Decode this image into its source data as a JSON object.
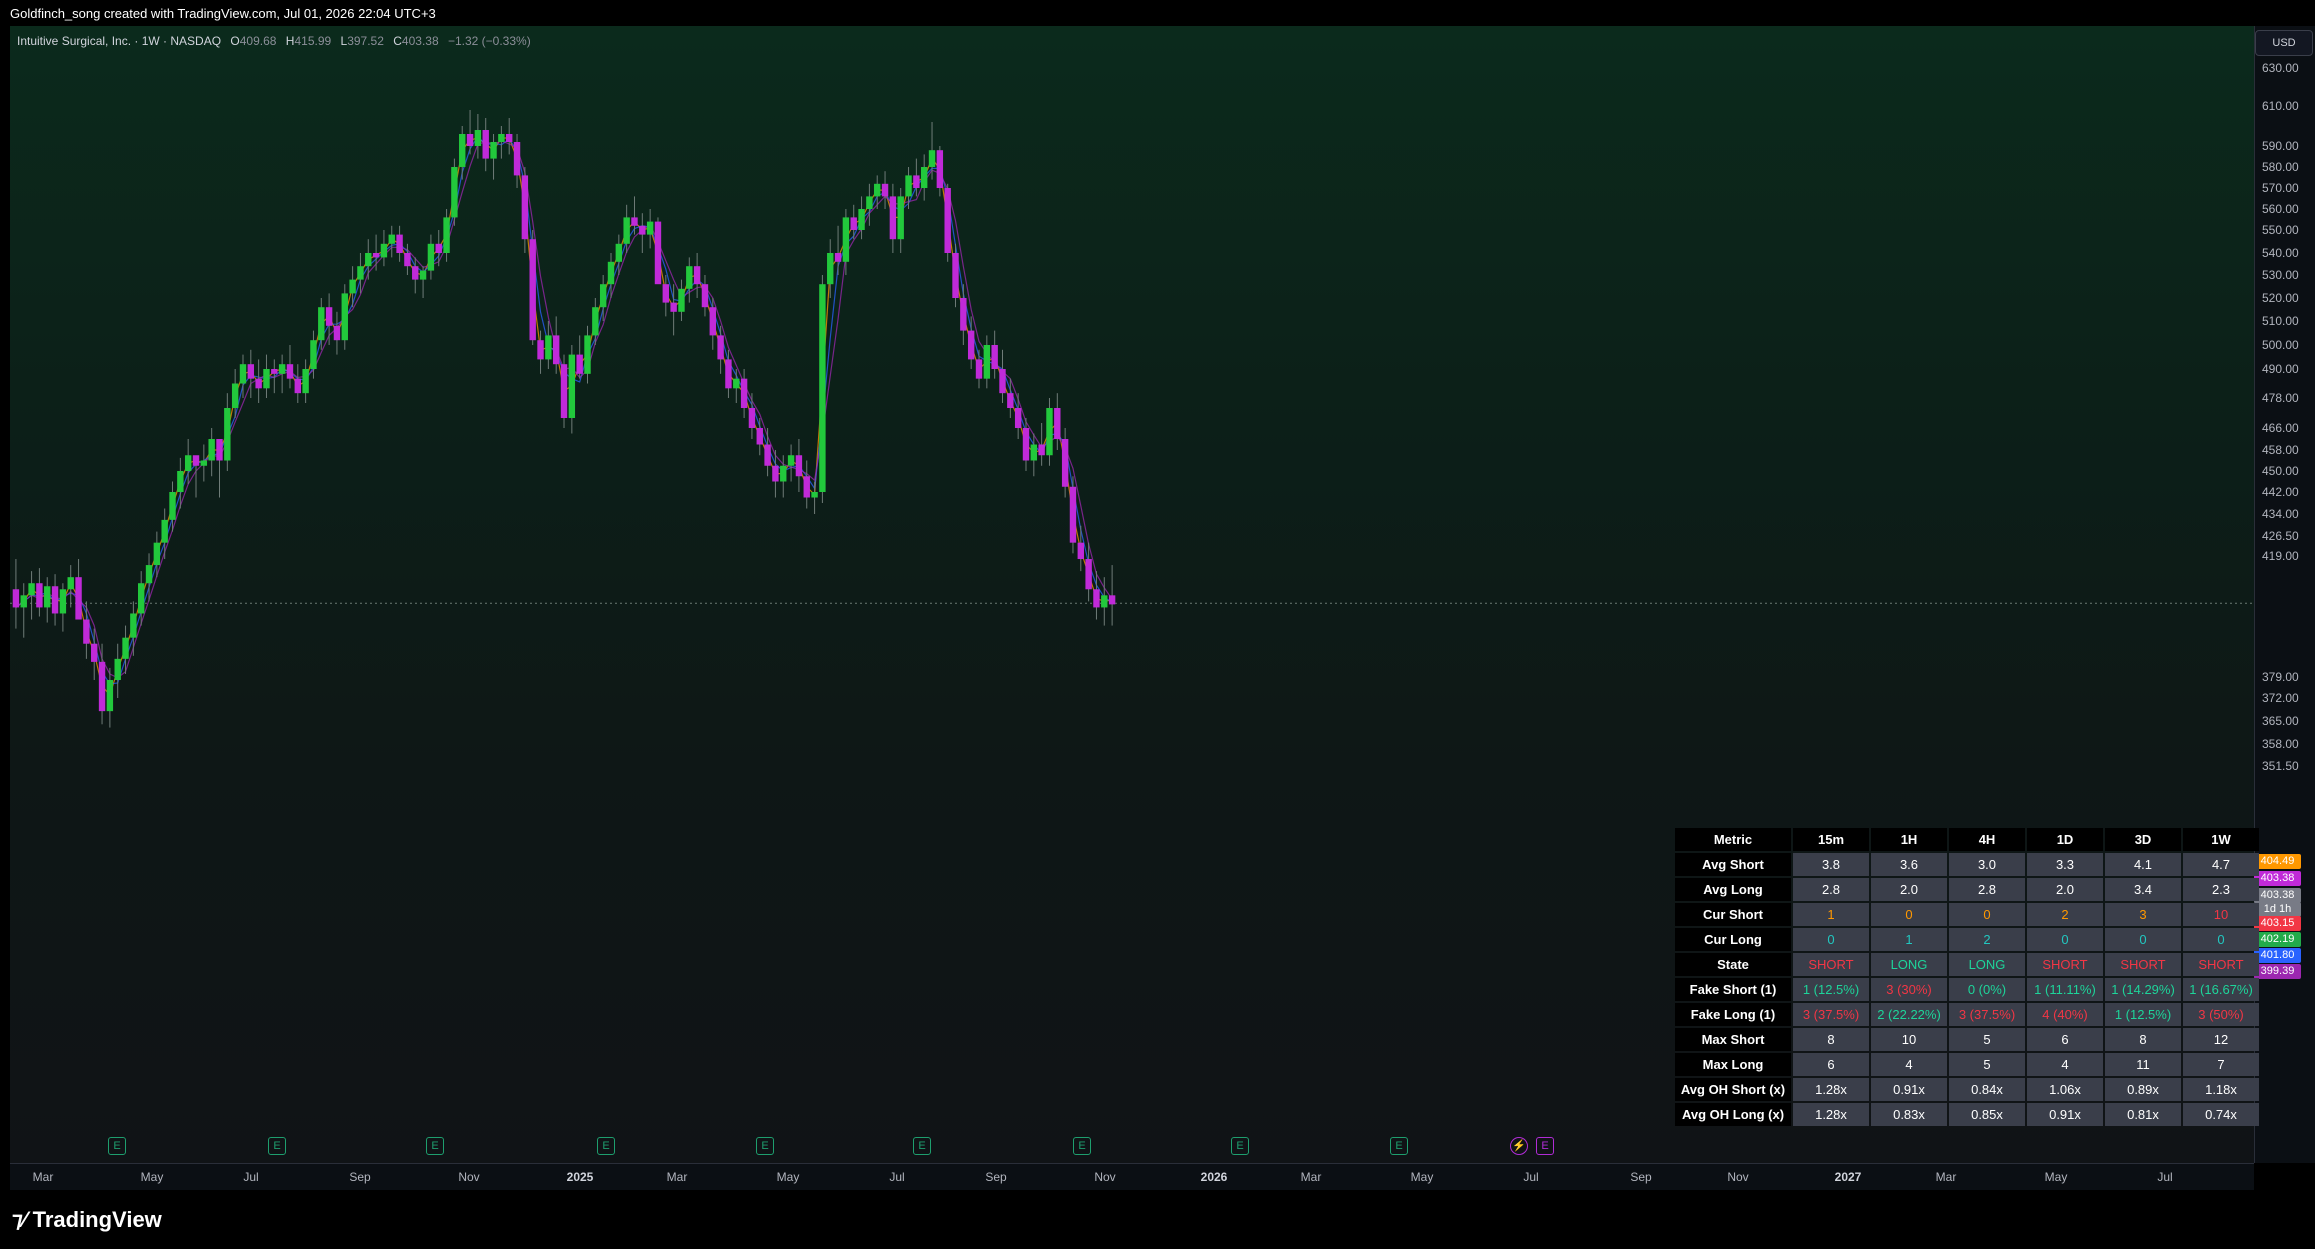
{
  "header": {
    "title": "Goldfinch_song created with TradingView.com, Jul 01, 2026 22:04 UTC+3"
  },
  "legend": {
    "symbol": "Intuitive Surgical, Inc. · 1W · NASDAQ",
    "o_label": "O",
    "o": "409.68",
    "h_label": "H",
    "h": "415.99",
    "l_label": "L",
    "l": "397.52",
    "c_label": "C",
    "c": "403.38",
    "chg": "−1.32 (−0.33%)"
  },
  "currency": "USD",
  "price_axis": [
    "630.00",
    "610.00",
    "590.00",
    "580.00",
    "570.00",
    "560.00",
    "550.00",
    "540.00",
    "530.00",
    "520.00",
    "510.00",
    "500.00",
    "490.00",
    "478.00",
    "466.00",
    "458.00",
    "450.00",
    "442.00",
    "434.00",
    "426.50",
    "419.00",
    "379.00",
    "372.00",
    "365.00",
    "358.00",
    "351.50"
  ],
  "price_tags": [
    {
      "text": "404.49",
      "color": "#ff9800"
    },
    {
      "text": "403.38",
      "color": "#c02ad8"
    },
    {
      "text": "403.38",
      "color": "#787b86"
    },
    {
      "text": "1d 1h",
      "color": "#787b86"
    },
    {
      "text": "403.15",
      "color": "#f23645"
    },
    {
      "text": "402.19",
      "color": "#22ab4a"
    },
    {
      "text": "401.80",
      "color": "#2962ff"
    },
    {
      "text": "399.39",
      "color": "#9c27b0"
    }
  ],
  "time_axis": [
    {
      "t": "Mar",
      "b": false
    },
    {
      "t": "May",
      "b": false
    },
    {
      "t": "Jul",
      "b": false
    },
    {
      "t": "Sep",
      "b": false
    },
    {
      "t": "Nov",
      "b": false
    },
    {
      "t": "2025",
      "b": true
    },
    {
      "t": "Mar",
      "b": false
    },
    {
      "t": "May",
      "b": false
    },
    {
      "t": "Jul",
      "b": false
    },
    {
      "t": "Sep",
      "b": false
    },
    {
      "t": "Nov",
      "b": false
    },
    {
      "t": "2026",
      "b": true
    },
    {
      "t": "Mar",
      "b": false
    },
    {
      "t": "May",
      "b": false
    },
    {
      "t": "Jul",
      "b": false
    },
    {
      "t": "Sep",
      "b": false
    },
    {
      "t": "Nov",
      "b": false
    },
    {
      "t": "2027",
      "b": true
    },
    {
      "t": "Mar",
      "b": false
    },
    {
      "t": "May",
      "b": false
    },
    {
      "t": "Jul",
      "b": false
    }
  ],
  "earnings_markers": [
    "E",
    "E",
    "E",
    "E",
    "E",
    "E",
    "E",
    "E",
    "E",
    "E"
  ],
  "table": {
    "headers": [
      "Metric",
      "15m",
      "1H",
      "4H",
      "1D",
      "3D",
      "1W"
    ],
    "rows": [
      {
        "metric": "Avg Short",
        "cells": [
          "3.8",
          "3.6",
          "3.0",
          "3.3",
          "4.1",
          "4.7"
        ],
        "colors": [
          "w",
          "w",
          "w",
          "w",
          "w",
          "w"
        ]
      },
      {
        "metric": "Avg Long",
        "cells": [
          "2.8",
          "2.0",
          "2.8",
          "2.0",
          "3.4",
          "2.3"
        ],
        "colors": [
          "w",
          "w",
          "w",
          "w",
          "w",
          "w"
        ]
      },
      {
        "metric": "Cur Short",
        "cells": [
          "1",
          "0",
          "0",
          "2",
          "3",
          "10"
        ],
        "colors": [
          "o",
          "o",
          "o",
          "o",
          "o",
          "r"
        ]
      },
      {
        "metric": "Cur Long",
        "cells": [
          "0",
          "1",
          "2",
          "0",
          "0",
          "0"
        ],
        "colors": [
          "cy",
          "cy",
          "cy",
          "cy",
          "cy",
          "cy"
        ]
      },
      {
        "metric": "State",
        "cells": [
          "SHORT",
          "LONG",
          "LONG",
          "SHORT",
          "SHORT",
          "SHORT"
        ],
        "colors": [
          "r",
          "g",
          "g",
          "r",
          "r",
          "r"
        ]
      },
      {
        "metric": "Fake Short (1)",
        "cells": [
          "1 (12.5%)",
          "3 (30%)",
          "0 (0%)",
          "1 (11.11%)",
          "1 (14.29%)",
          "1 (16.67%)"
        ],
        "colors": [
          "g",
          "r",
          "g",
          "g",
          "g",
          "g"
        ]
      },
      {
        "metric": "Fake Long (1)",
        "cells": [
          "3 (37.5%)",
          "2 (22.22%)",
          "3 (37.5%)",
          "4 (40%)",
          "1 (12.5%)",
          "3 (50%)"
        ],
        "colors": [
          "r",
          "g",
          "r",
          "r",
          "g",
          "r"
        ]
      },
      {
        "metric": "Max Short",
        "cells": [
          "8",
          "10",
          "5",
          "6",
          "8",
          "12"
        ],
        "colors": [
          "w",
          "w",
          "w",
          "w",
          "w",
          "w"
        ]
      },
      {
        "metric": "Max Long",
        "cells": [
          "6",
          "4",
          "5",
          "4",
          "11",
          "7"
        ],
        "colors": [
          "w",
          "w",
          "w",
          "w",
          "w",
          "w"
        ]
      },
      {
        "metric": "Avg OH Short (x)",
        "cells": [
          "1.28x",
          "0.91x",
          "0.84x",
          "1.06x",
          "0.89x",
          "1.18x"
        ],
        "colors": [
          "w",
          "w",
          "w",
          "w",
          "w",
          "w"
        ]
      },
      {
        "metric": "Avg OH Long (x)",
        "cells": [
          "1.28x",
          "0.83x",
          "0.85x",
          "0.91x",
          "0.81x",
          "0.74x"
        ],
        "colors": [
          "w",
          "w",
          "w",
          "w",
          "w",
          "w"
        ]
      }
    ]
  },
  "candles": [
    [
      408,
      418,
      395,
      402
    ],
    [
      402,
      410,
      392,
      406
    ],
    [
      406,
      414,
      398,
      410
    ],
    [
      410,
      415,
      399,
      402
    ],
    [
      402,
      412,
      397,
      409
    ],
    [
      409,
      413,
      396,
      400
    ],
    [
      400,
      410,
      394,
      408
    ],
    [
      408,
      416,
      402,
      412
    ],
    [
      412,
      418,
      405,
      398
    ],
    [
      398,
      404,
      385,
      390
    ],
    [
      390,
      395,
      378,
      384
    ],
    [
      384,
      390,
      364,
      368
    ],
    [
      368,
      382,
      363,
      378
    ],
    [
      378,
      390,
      372,
      385
    ],
    [
      385,
      396,
      380,
      392
    ],
    [
      392,
      404,
      386,
      400
    ],
    [
      400,
      414,
      396,
      410
    ],
    [
      410,
      420,
      404,
      416
    ],
    [
      416,
      428,
      412,
      424
    ],
    [
      424,
      436,
      418,
      432
    ],
    [
      432,
      446,
      428,
      442
    ],
    [
      442,
      455,
      436,
      450
    ],
    [
      450,
      462,
      445,
      456
    ],
    [
      456,
      455,
      440,
      452
    ],
    [
      452,
      460,
      446,
      454
    ],
    [
      454,
      466,
      448,
      462
    ],
    [
      462,
      458,
      440,
      454
    ],
    [
      454,
      480,
      450,
      474
    ],
    [
      474,
      490,
      470,
      484
    ],
    [
      484,
      496,
      478,
      492
    ],
    [
      492,
      498,
      478,
      486
    ],
    [
      486,
      494,
      476,
      482
    ],
    [
      482,
      496,
      478,
      490
    ],
    [
      490,
      494,
      480,
      488
    ],
    [
      488,
      496,
      480,
      492
    ],
    [
      492,
      500,
      482,
      486
    ],
    [
      486,
      492,
      476,
      480
    ],
    [
      480,
      494,
      476,
      490
    ],
    [
      490,
      506,
      486,
      502
    ],
    [
      502,
      520,
      498,
      516
    ],
    [
      516,
      522,
      500,
      508
    ],
    [
      508,
      514,
      496,
      502
    ],
    [
      502,
      526,
      498,
      522
    ],
    [
      522,
      534,
      516,
      528
    ],
    [
      528,
      540,
      522,
      534
    ],
    [
      534,
      546,
      528,
      540
    ],
    [
      540,
      548,
      532,
      538
    ],
    [
      538,
      550,
      534,
      544
    ],
    [
      544,
      552,
      538,
      548
    ],
    [
      548,
      552,
      536,
      540
    ],
    [
      540,
      544,
      530,
      534
    ],
    [
      534,
      538,
      522,
      528
    ],
    [
      528,
      534,
      520,
      532
    ],
    [
      532,
      548,
      528,
      544
    ],
    [
      544,
      550,
      534,
      540
    ],
    [
      540,
      560,
      536,
      556
    ],
    [
      556,
      584,
      552,
      580
    ],
    [
      580,
      600,
      574,
      596
    ],
    [
      596,
      608,
      586,
      590
    ],
    [
      590,
      606,
      584,
      598
    ],
    [
      598,
      604,
      578,
      584
    ],
    [
      584,
      596,
      574,
      592
    ],
    [
      592,
      600,
      584,
      596
    ],
    [
      596,
      604,
      586,
      592
    ],
    [
      592,
      596,
      570,
      576
    ],
    [
      576,
      580,
      540,
      546
    ],
    [
      546,
      550,
      500,
      502
    ],
    [
      502,
      506,
      488,
      494
    ],
    [
      494,
      510,
      490,
      504
    ],
    [
      504,
      512,
      488,
      492
    ],
    [
      492,
      496,
      466,
      470
    ],
    [
      470,
      500,
      464,
      496
    ],
    [
      496,
      504,
      486,
      488
    ],
    [
      488,
      508,
      484,
      504
    ],
    [
      504,
      520,
      500,
      516
    ],
    [
      516,
      530,
      510,
      526
    ],
    [
      526,
      540,
      520,
      536
    ],
    [
      536,
      548,
      530,
      544
    ],
    [
      544,
      562,
      540,
      556
    ],
    [
      556,
      566,
      548,
      552
    ],
    [
      552,
      558,
      540,
      548
    ],
    [
      548,
      560,
      542,
      554
    ],
    [
      554,
      556,
      532,
      526
    ],
    [
      526,
      530,
      512,
      518
    ],
    [
      518,
      526,
      504,
      514
    ],
    [
      514,
      528,
      510,
      524
    ],
    [
      524,
      538,
      518,
      534
    ],
    [
      534,
      540,
      520,
      526
    ],
    [
      526,
      530,
      512,
      516
    ],
    [
      516,
      520,
      498,
      504
    ],
    [
      504,
      508,
      488,
      494
    ],
    [
      494,
      498,
      478,
      482
    ],
    [
      482,
      490,
      476,
      486
    ],
    [
      486,
      490,
      470,
      474
    ],
    [
      474,
      480,
      462,
      466
    ],
    [
      466,
      470,
      456,
      460
    ],
    [
      460,
      466,
      448,
      452
    ],
    [
      452,
      458,
      440,
      446
    ],
    [
      446,
      456,
      440,
      452
    ],
    [
      452,
      460,
      446,
      456
    ],
    [
      456,
      462,
      442,
      448
    ],
    [
      448,
      454,
      436,
      440
    ],
    [
      440,
      446,
      434,
      442
    ],
    [
      442,
      530,
      438,
      526
    ],
    [
      526,
      546,
      520,
      540
    ],
    [
      540,
      552,
      530,
      536
    ],
    [
      536,
      560,
      530,
      556
    ],
    [
      556,
      562,
      546,
      550
    ],
    [
      550,
      566,
      546,
      560
    ],
    [
      560,
      572,
      552,
      566
    ],
    [
      566,
      576,
      560,
      572
    ],
    [
      572,
      578,
      560,
      566
    ],
    [
      566,
      572,
      540,
      546
    ],
    [
      546,
      570,
      540,
      566
    ],
    [
      566,
      580,
      560,
      576
    ],
    [
      576,
      584,
      566,
      570
    ],
    [
      570,
      586,
      564,
      580
    ],
    [
      580,
      602,
      574,
      588
    ],
    [
      588,
      590,
      566,
      570
    ],
    [
      570,
      572,
      536,
      540
    ],
    [
      540,
      544,
      516,
      520
    ],
    [
      520,
      526,
      500,
      506
    ],
    [
      506,
      512,
      490,
      494
    ],
    [
      494,
      498,
      482,
      486
    ],
    [
      486,
      504,
      482,
      500
    ],
    [
      500,
      506,
      486,
      490
    ],
    [
      490,
      498,
      476,
      480
    ],
    [
      480,
      486,
      470,
      474
    ],
    [
      474,
      480,
      462,
      466
    ],
    [
      466,
      470,
      450,
      454
    ],
    [
      454,
      464,
      448,
      460
    ],
    [
      460,
      468,
      452,
      456
    ],
    [
      456,
      478,
      452,
      474
    ],
    [
      474,
      480,
      458,
      462
    ],
    [
      462,
      466,
      440,
      444
    ],
    [
      444,
      448,
      420,
      424
    ],
    [
      424,
      430,
      414,
      418
    ],
    [
      418,
      424,
      404,
      408
    ],
    [
      408,
      414,
      398,
      402
    ],
    [
      402,
      412,
      396,
      406
    ],
    [
      406,
      416,
      396,
      403
    ]
  ]
}
